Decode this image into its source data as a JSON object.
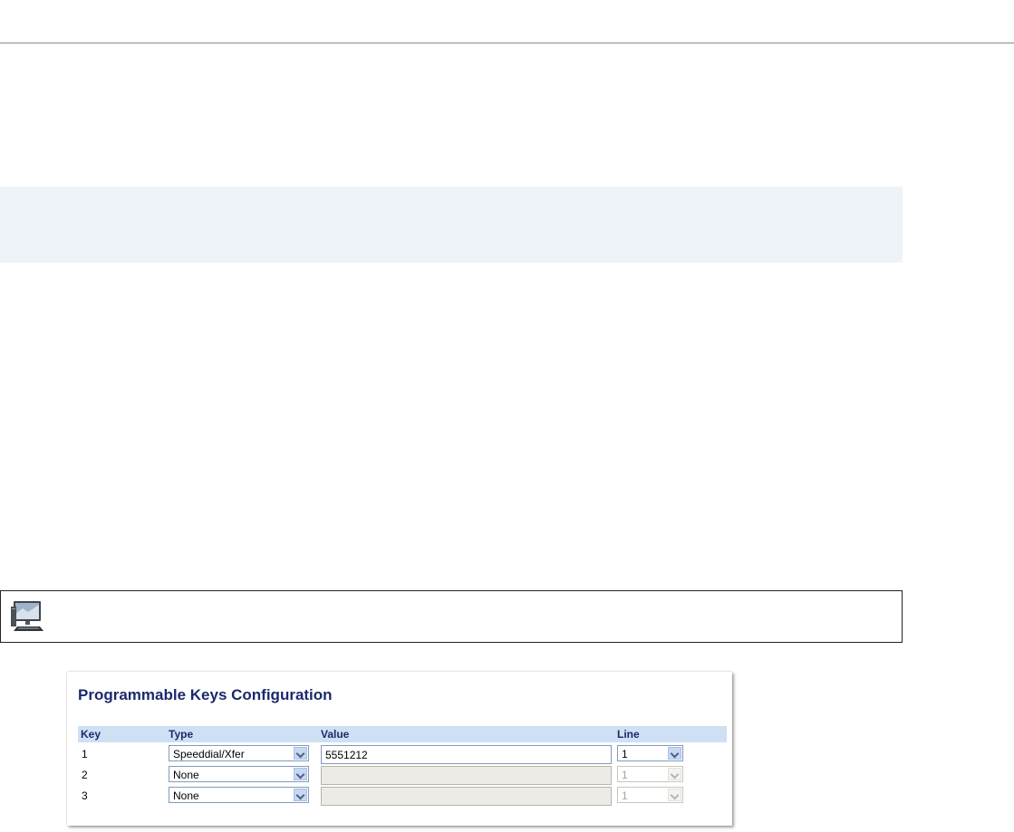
{
  "panel": {
    "title": "Programmable Keys Configuration",
    "columns": {
      "key": "Key",
      "type": "Type",
      "value": "Value",
      "line": "Line"
    },
    "rows": [
      {
        "key": "1",
        "type": "Speeddial/Xfer",
        "value": "5551212",
        "line": "1",
        "enabled": true
      },
      {
        "key": "2",
        "type": "None",
        "value": "",
        "line": "1",
        "enabled": false
      },
      {
        "key": "3",
        "type": "None",
        "value": "",
        "line": "1",
        "enabled": false
      }
    ]
  },
  "icons": {
    "webui": "computer-monitor-icon",
    "dropdown": "chevron-down-icon"
  },
  "colors": {
    "title": "#1a2a6c",
    "header_bg": "#cfe0f4",
    "info_band": "#eef3fa",
    "input_border": "#7f9db9",
    "disabled_input_bg": "#ecebe5"
  }
}
